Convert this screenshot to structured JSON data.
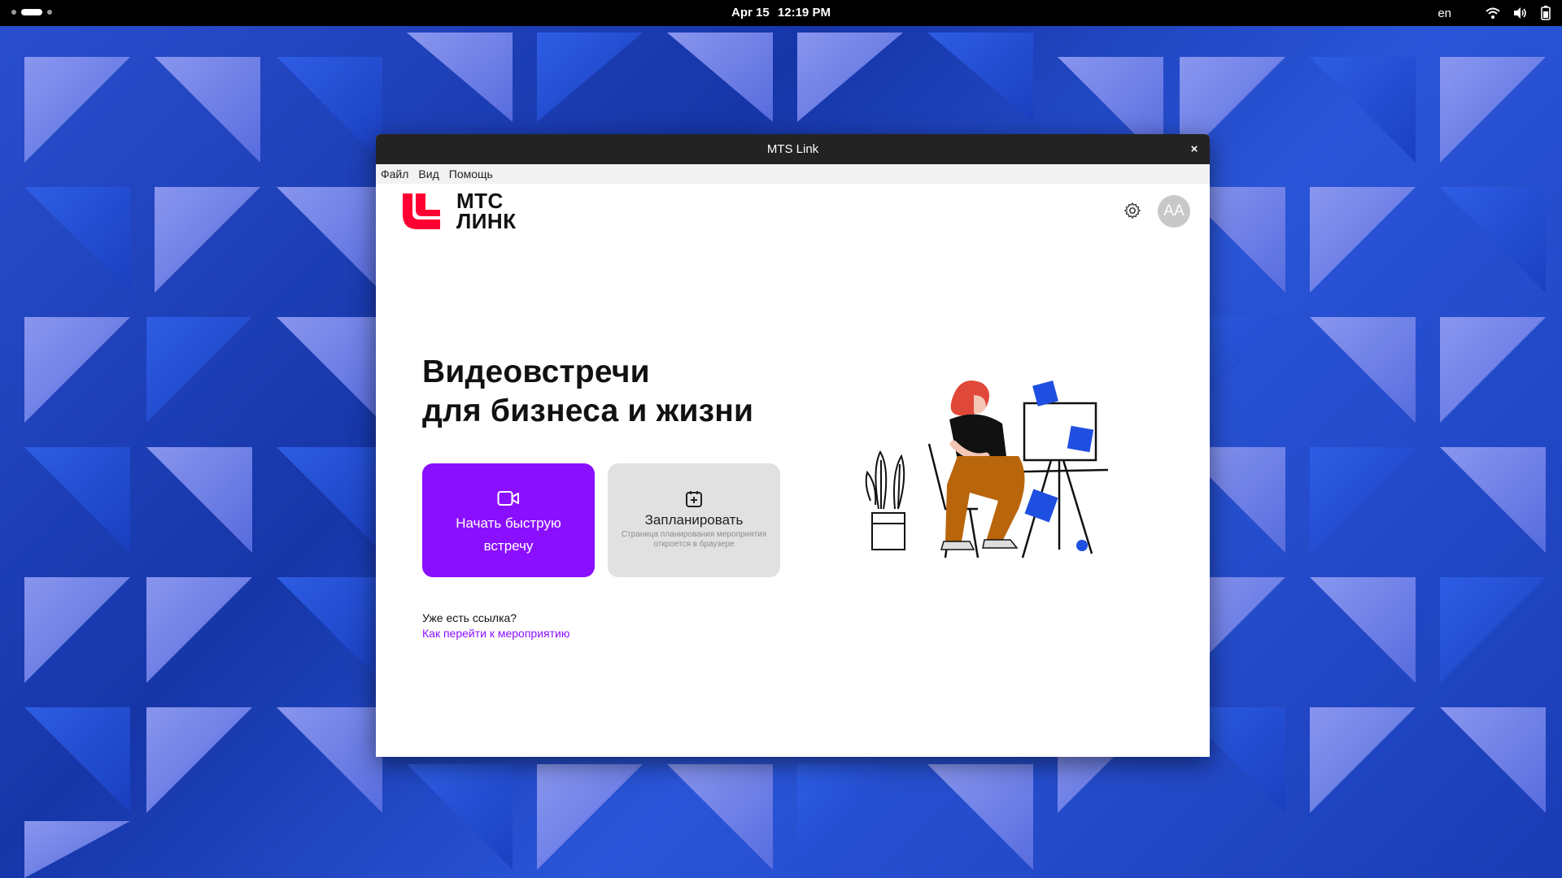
{
  "topbar": {
    "date": "Apr 15",
    "time": "12:19 PM",
    "language": "en",
    "icons": [
      "wifi-icon",
      "volume-icon",
      "battery-icon"
    ]
  },
  "window": {
    "title": "MTS Link",
    "close_label": "×"
  },
  "menu": {
    "items": [
      "Файл",
      "Вид",
      "Помощь"
    ]
  },
  "header": {
    "logo_line1": "МТС",
    "logo_line2": "ЛИНК",
    "avatar_initials": "AA",
    "icons": [
      "settings-gear-icon"
    ]
  },
  "main": {
    "headline_line1": "Видеовстречи",
    "headline_line2": "для бизнеса и жизни",
    "quick_meeting_label": "Начать быструю встречу",
    "schedule_label": "Запланировать",
    "schedule_hint": "Страница планирования мероприятия откроется в браузере",
    "already_have_link": "Уже есть ссылка?",
    "how_to_join": "Как перейти к мероприятию"
  },
  "colors": {
    "accent": "#8b0fff",
    "brand_red": "#ff0032",
    "secondary_button": "#e1e1e1",
    "illustration_blue": "#1f4fe0"
  }
}
